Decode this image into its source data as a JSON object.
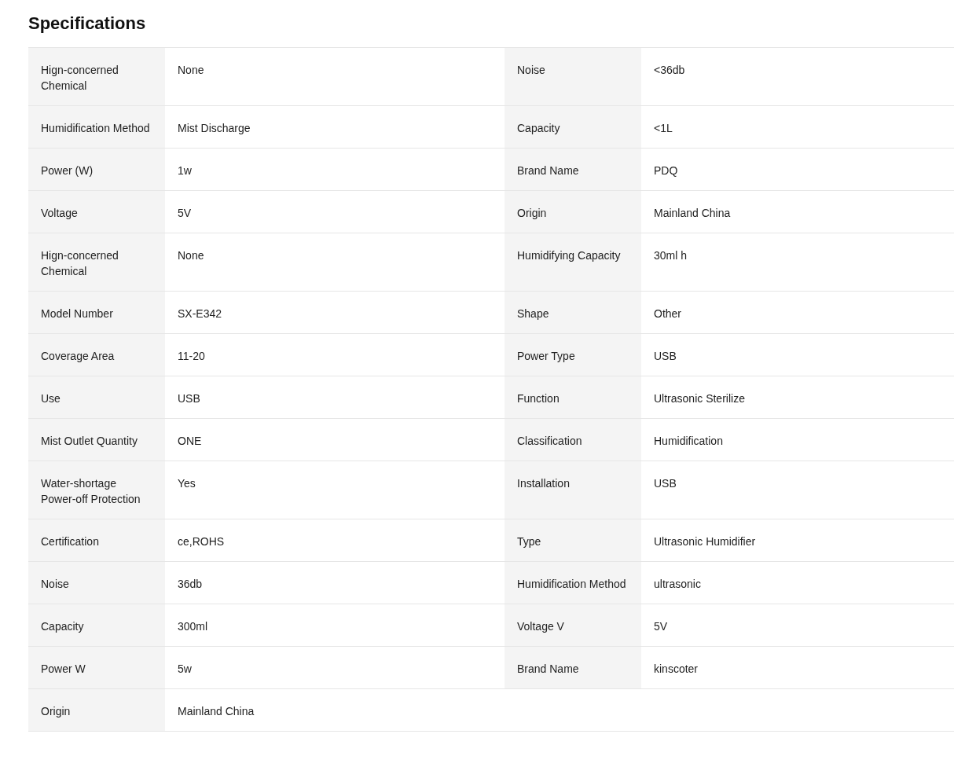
{
  "title": "Specifications",
  "rows": [
    [
      {
        "label": "Hign-concerned Chemical",
        "value": "None"
      },
      {
        "label": "Noise",
        "value": "<36db"
      }
    ],
    [
      {
        "label": "Humidification Method",
        "value": "Mist Discharge"
      },
      {
        "label": "Capacity",
        "value": "<1L"
      }
    ],
    [
      {
        "label": "Power (W)",
        "value": "1w"
      },
      {
        "label": "Brand Name",
        "value": "PDQ"
      }
    ],
    [
      {
        "label": "Voltage",
        "value": "5V"
      },
      {
        "label": "Origin",
        "value": "Mainland China"
      }
    ],
    [
      {
        "label": "Hign-concerned Chemical",
        "value": "None"
      },
      {
        "label": "Humidifying Capacity",
        "value": "30ml h"
      }
    ],
    [
      {
        "label": "Model Number",
        "value": "SX-E342"
      },
      {
        "label": "Shape",
        "value": "Other"
      }
    ],
    [
      {
        "label": "Coverage Area",
        "value": "11-20"
      },
      {
        "label": "Power Type",
        "value": "USB"
      }
    ],
    [
      {
        "label": "Use",
        "value": "USB"
      },
      {
        "label": "Function",
        "value": "Ultrasonic Sterilize"
      }
    ],
    [
      {
        "label": "Mist Outlet Quantity",
        "value": "ONE"
      },
      {
        "label": "Classification",
        "value": "Humidification"
      }
    ],
    [
      {
        "label": "Water-shortage Power-off Protection",
        "value": "Yes"
      },
      {
        "label": "Installation",
        "value": "USB"
      }
    ],
    [
      {
        "label": "Certification",
        "value": "ce,ROHS"
      },
      {
        "label": "Type",
        "value": "Ultrasonic Humidifier"
      }
    ],
    [
      {
        "label": "Noise",
        "value": "36db"
      },
      {
        "label": "Humidification Method",
        "value": "ultrasonic"
      }
    ],
    [
      {
        "label": "Capacity",
        "value": "300ml"
      },
      {
        "label": "Voltage V",
        "value": "5V"
      }
    ],
    [
      {
        "label": "Power W",
        "value": "5w"
      },
      {
        "label": "Brand Name",
        "value": "kinscoter"
      }
    ],
    [
      {
        "label": "Origin",
        "value": "Mainland China"
      }
    ]
  ]
}
